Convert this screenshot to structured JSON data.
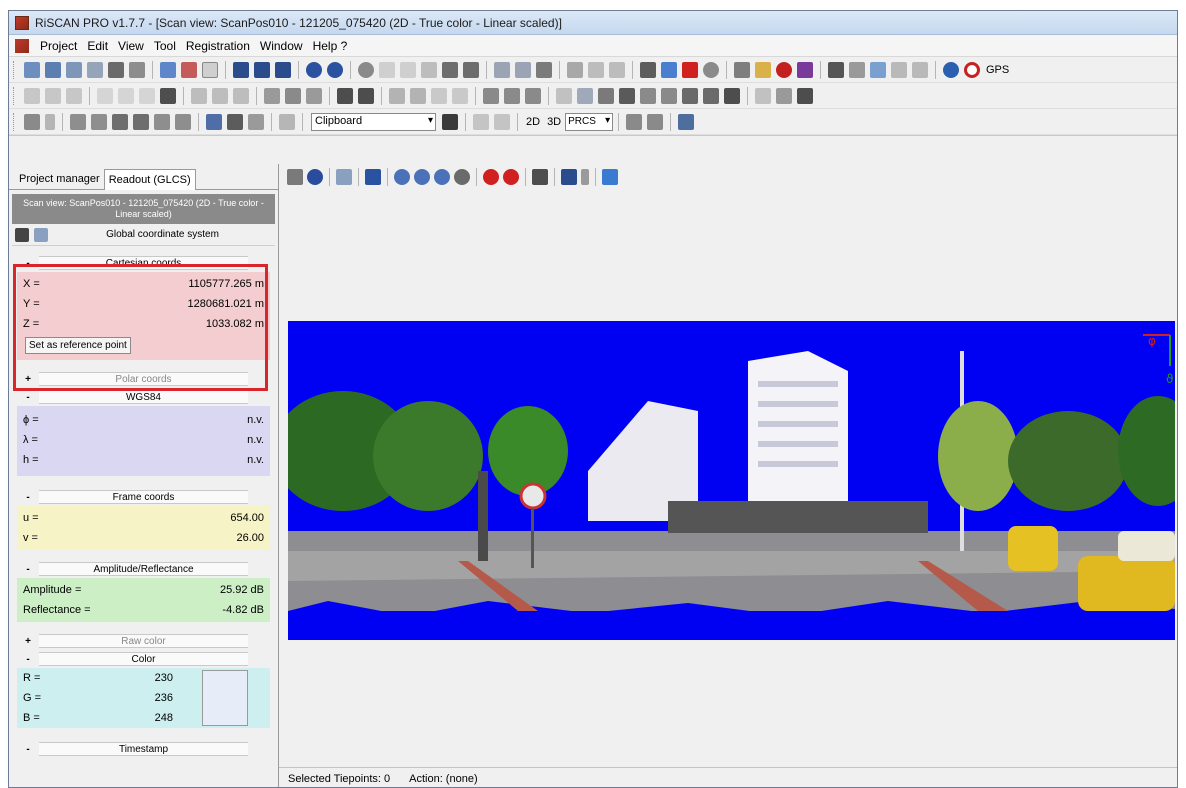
{
  "window": {
    "title": "RiSCAN PRO v1.7.7 - [Scan view: ScanPos010 - 121205_075420 (2D - True color - Linear scaled)]"
  },
  "menu": [
    "Project",
    "Edit",
    "View",
    "Tool",
    "Registration",
    "Window",
    "Help ?"
  ],
  "toolbar": {
    "gps_label": "GPS",
    "clipboard_value": "Clipboard",
    "btn_2d": "2D",
    "btn_3d": "3D",
    "prcs_value": "PRCS"
  },
  "tabs": {
    "project_manager": "Project manager",
    "readout": "Readout (GLCS)"
  },
  "readout": {
    "scan_header": "Scan view: ScanPos010 - 121205_075420 (2D - True color - Linear scaled)",
    "coordinate_system": "Global coordinate system",
    "cartesian": {
      "title": "Cartesian coords",
      "toggle": "-",
      "x_label": "X =",
      "x_value": "1105777.265 m",
      "y_label": "Y =",
      "y_value": "1280681.021 m",
      "z_label": "Z =",
      "z_value": "1033.082 m",
      "ref_button": "Set as reference point"
    },
    "polar": {
      "title": "Polar coords",
      "toggle": "+"
    },
    "wgs84": {
      "title": "WGS84",
      "toggle": "-",
      "phi_label": "ϕ =",
      "phi_value": "n.v.",
      "lambda_label": "λ =",
      "lambda_value": "n.v.",
      "h_label": "h =",
      "h_value": "n.v."
    },
    "frame": {
      "title": "Frame coords",
      "toggle": "-",
      "u_label": "u =",
      "u_value": "654.00",
      "v_label": "v =",
      "v_value": "26.00"
    },
    "amplitude": {
      "title": "Amplitude/Reflectance",
      "toggle": "-",
      "amp_label": "Amplitude =",
      "amp_value": "25.92 dB",
      "refl_label": "Reflectance =",
      "refl_value": "-4.82 dB"
    },
    "raw_color": {
      "title": "Raw color",
      "toggle": "+"
    },
    "color": {
      "title": "Color",
      "toggle": "-",
      "r_label": "R =",
      "r_value": "230",
      "g_label": "G =",
      "g_value": "236",
      "b_label": "B =",
      "b_value": "248",
      "swatch_color": "#e6ecf8"
    },
    "timestamp": {
      "title": "Timestamp",
      "toggle": "-"
    }
  },
  "scan_view": {
    "background_color": "#0000f3",
    "axis_phi": "φ",
    "axis_theta": "ϑ"
  },
  "status": {
    "selected_tiepoints": "Selected Tiepoints: 0",
    "action": "Action: (none)"
  },
  "colors": {
    "cartesian_bg": "#f3cdcf",
    "wgs84_bg": "#d9d7f1",
    "frame_bg": "#f6f4c6",
    "amplitude_bg": "#ccefc6",
    "color_bg": "#cdeff0",
    "highlight_border": "#d9262a"
  }
}
